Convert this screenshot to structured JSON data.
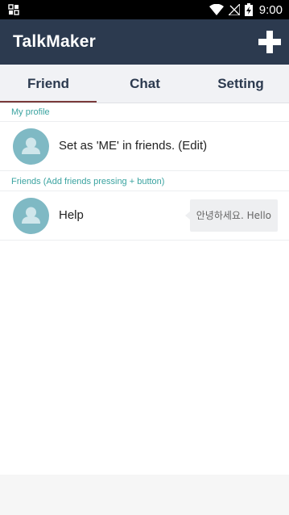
{
  "status_bar": {
    "time": "9:00",
    "left_icon": "app-notification-icon",
    "wifi_icon": "wifi-icon",
    "signal_icon": "no-signal-icon",
    "battery_icon": "battery-charging-icon"
  },
  "app_bar": {
    "title": "TalkMaker",
    "add_icon": "plus-icon"
  },
  "tabs": [
    {
      "label": "Friend",
      "selected": true
    },
    {
      "label": "Chat",
      "selected": false
    },
    {
      "label": "Setting",
      "selected": false
    }
  ],
  "profile_section": {
    "header": "My profile",
    "item": {
      "label": "Set as 'ME' in friends. (Edit)",
      "avatar_icon": "default-person-avatar"
    }
  },
  "friends_section": {
    "header": "Friends (Add friends pressing + button)",
    "items": [
      {
        "name": "Help",
        "avatar_icon": "default-person-avatar",
        "status_message": "안녕하세요. Hello"
      }
    ]
  },
  "colors": {
    "app_bar": "#2c3a4f",
    "tab_bar": "#f1f2f5",
    "section_header_text": "#3aa3a0",
    "avatar_bg": "#7fb9c4",
    "tab_indicator": "#7a3a3a"
  }
}
